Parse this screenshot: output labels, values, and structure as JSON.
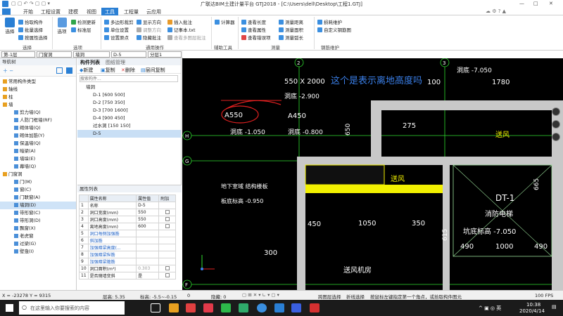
{
  "window": {
    "title": "广联达BIM土建计量平台 GTJ2018 - [C:\\Users\\dell\\Desktop\\工程1.GTJ]",
    "controls": [
      "—",
      "□",
      "✕"
    ]
  },
  "tabs": [
    "开始",
    "工程设置",
    "建模",
    "视图",
    "工具",
    "工程量",
    "云应用"
  ],
  "active_tab": "工具",
  "ribbon": {
    "select": "选择",
    "pick": "拾取构件",
    "batch": "批量选择",
    "attr_select": "按属性选择",
    "options": "选项",
    "check_update": "检测更新",
    "std_layer": "标准层",
    "poly_cut": "多边形裁剪",
    "unit_set": "单位设置",
    "set_origin": "设置原点",
    "show_dir": "显示方向",
    "adjust_dir": "调整方向",
    "hide_note": "隐藏批注",
    "batch_note": "插入批注",
    "notepad": "记事本.txt",
    "img_note": "查看多图层批注",
    "calculator": "计算器",
    "check_len": "查看长度",
    "check_attr": "查看属性",
    "check_error": "查看错误项",
    "measure_dist": "测量距离",
    "measure_area": "测量面积",
    "measure_arc": "测量弧长",
    "rebar_maint": "损耗维护",
    "custom_rebar": "自定义钢筋图",
    "groups": [
      "选择",
      "选项",
      "通用操作",
      "辅助工具",
      "测量",
      "钢筋维护"
    ]
  },
  "selectors": {
    "floor": "第-1层",
    "category": "门窗洞",
    "type": "墙洞",
    "item": "D-5",
    "layer": "分层1"
  },
  "nav": {
    "header": "导航树",
    "items": [
      {
        "label": "常用构件类型",
        "level": 0
      },
      {
        "label": "轴线",
        "level": 0
      },
      {
        "label": "柱",
        "level": 0
      },
      {
        "label": "墙",
        "level": 0
      },
      {
        "label": "剪力墙(Q)",
        "level": 1
      },
      {
        "label": "人防门框墙(RF)",
        "level": 1
      },
      {
        "label": "砌体墙(Q)",
        "level": 1
      },
      {
        "label": "砌体加筋(Y)",
        "level": 1
      },
      {
        "label": "保温墙(Q)",
        "level": 1
      },
      {
        "label": "暗梁(A)",
        "level": 1
      },
      {
        "label": "墙垛(E)",
        "level": 1
      },
      {
        "label": "幕墙(Q)",
        "level": 1
      },
      {
        "label": "门窗洞",
        "level": 0
      },
      {
        "label": "门(M)",
        "level": 1
      },
      {
        "label": "窗(C)",
        "level": 1
      },
      {
        "label": "门联窗(A)",
        "level": 1
      },
      {
        "label": "墙洞(D)",
        "level": 1,
        "selected": true
      },
      {
        "label": "带形窗(C)",
        "level": 1
      },
      {
        "label": "带形洞(D)",
        "level": 1
      },
      {
        "label": "飘窗(X)",
        "level": 1
      },
      {
        "label": "老虎窗",
        "level": 1
      },
      {
        "label": "过梁(G)",
        "level": 1
      },
      {
        "label": "壁龛(I)",
        "level": 1
      }
    ]
  },
  "list": {
    "tabs": [
      "构件列表",
      "图纸管理"
    ],
    "toolbar": [
      "新建",
      "复制",
      "删除",
      "层间复制"
    ],
    "search_placeholder": "搜索构件...",
    "root": "墙洞",
    "items": [
      "D-1 [600 500]",
      "D-2 [750 350]",
      "D-3 [700 1600]",
      "D-4 [900 450]",
      "过水洞 [150 150]",
      "D-5"
    ],
    "selected": "D-5"
  },
  "props": {
    "header": "属性列表",
    "columns": [
      "属性名称",
      "属性值",
      "附加"
    ],
    "rows": [
      {
        "n": "1",
        "name": "名称",
        "value": "D-5",
        "blue": false
      },
      {
        "n": "2",
        "name": "洞口宽度(mm)",
        "value": "550",
        "blue": false
      },
      {
        "n": "3",
        "name": "洞口高度(mm)",
        "value": "550",
        "blue": false
      },
      {
        "n": "4",
        "name": "离地高度(mm)",
        "value": "600",
        "blue": false
      },
      {
        "n": "5",
        "name": "洞口每侧加强筋",
        "value": "",
        "blue": true
      },
      {
        "n": "6",
        "name": "斜加筋",
        "value": "",
        "blue": true
      },
      {
        "n": "7",
        "name": "加强暗梁高度(...",
        "value": "",
        "blue": true
      },
      {
        "n": "8",
        "name": "加强暗梁纵筋",
        "value": "",
        "blue": true
      },
      {
        "n": "9",
        "name": "加强暗梁箍筋",
        "value": "",
        "blue": true
      },
      {
        "n": "10",
        "name": "洞口面积(m²)",
        "value": "0.303",
        "blue": false
      },
      {
        "n": "11",
        "name": "是否随墙变斜",
        "value": "是",
        "blue": false
      }
    ]
  },
  "drawing": {
    "annotation": "这个是表示离地高度吗",
    "labels": [
      "550 X 2000",
      "洞底 -2.900",
      "A550",
      "A450",
      "洞底 -1.050",
      "洞底 -0.800",
      "洞底 -7.050",
      "100",
      "1780",
      "275",
      "送风",
      "DT-1",
      "消防电梯",
      "坑底标高 -7.050",
      "送风机房",
      "地下室域 结构楼板",
      "板底标高 -0.950",
      "450",
      "1050",
      "350",
      "490",
      "1000",
      "490",
      "300",
      "650",
      "615",
      "665"
    ],
    "axes": [
      "2",
      "3",
      "H",
      "G",
      "F",
      "2",
      "3"
    ]
  },
  "status": {
    "coords": "X = -23278 Y = 9315",
    "floor_h": "层高:  5.35",
    "elev": "标高:  -5.5~-0.15",
    "zero": "0",
    "hidden": "隐藏:  0",
    "cross_select": "跨图层选择",
    "polyline": "折线选择",
    "hint": "按鼠标左键指定第一个角点，或拾取构件图元",
    "fps": "100 FPS"
  },
  "taskbar": {
    "search": "在这里输入你要搜索的内容",
    "time": "10:38",
    "date": "2020/4/14"
  },
  "colors": {
    "accent": "#2a7fd4",
    "canvas_bg": "#000000",
    "dim_green": "#2fdc2f",
    "wall_gray": "#c8c8c8",
    "hatch_yellow": "#f2f000",
    "red": "#e02020"
  }
}
